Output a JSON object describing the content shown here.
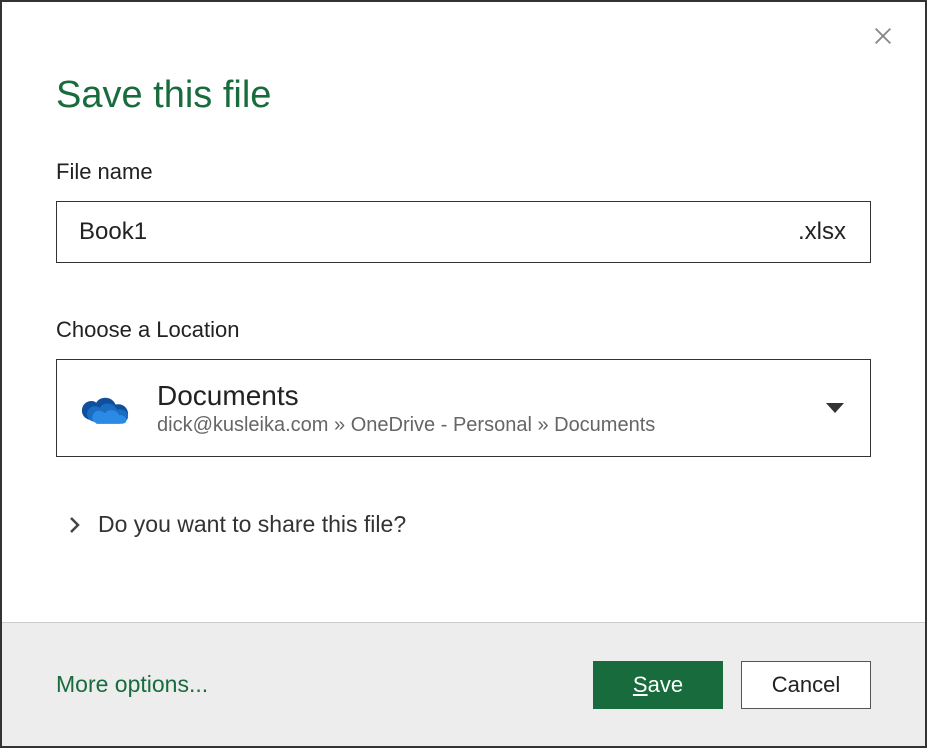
{
  "dialog": {
    "title": "Save this file"
  },
  "filename": {
    "label": "File name",
    "value": "Book1",
    "extension": ".xlsx"
  },
  "location": {
    "label": "Choose a Location",
    "name": "Documents",
    "path": "dick@kusleika.com » OneDrive - Personal » Documents"
  },
  "share": {
    "label": "Do you want to share this file?"
  },
  "footer": {
    "more_options": "More options...",
    "save_prefix": "S",
    "save_rest": "ave",
    "cancel": "Cancel"
  }
}
